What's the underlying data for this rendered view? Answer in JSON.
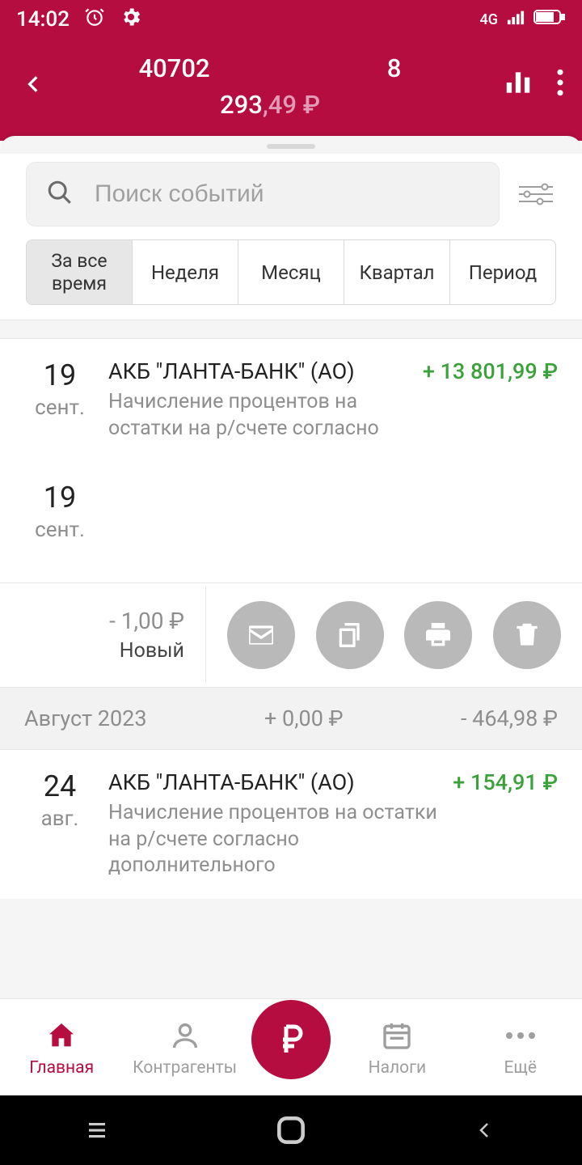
{
  "status": {
    "time": "14:02",
    "network_label": "4G"
  },
  "header": {
    "account_left": "40702",
    "account_right": "8",
    "balance_int": "293",
    "balance_dec": ",49 ₽"
  },
  "search": {
    "placeholder": "Поиск событий"
  },
  "segments": {
    "all": "За все время",
    "week": "Неделя",
    "month": "Месяц",
    "quarter": "Квартал",
    "period": "Период"
  },
  "txn1": {
    "day": "19",
    "mon": "сент.",
    "title": "АКБ \"ЛАНТА-БАНК\" (АО)",
    "desc": "Начисление процентов на остатки на р/счете согласно",
    "amount": "+ 13 801,99 ₽"
  },
  "txn_empty": {
    "day": "19",
    "mon": "сент."
  },
  "selected": {
    "amount": "- 1,00 ₽",
    "status": "Новый"
  },
  "month_sum": {
    "label": "Август 2023",
    "inflow": "+ 0,00 ₽",
    "outflow": "- 464,98 ₽"
  },
  "txn3": {
    "day": "24",
    "mon": "авг.",
    "title": "АКБ \"ЛАНТА-БАНК\" (АО)",
    "desc": "Начисление процентов на остатки на р/счете согласно дополнительного",
    "amount": "+ 154,91 ₽"
  },
  "nav": {
    "home": "Главная",
    "contractors": "Контрагенты",
    "taxes": "Налоги",
    "more": "Ещё"
  }
}
